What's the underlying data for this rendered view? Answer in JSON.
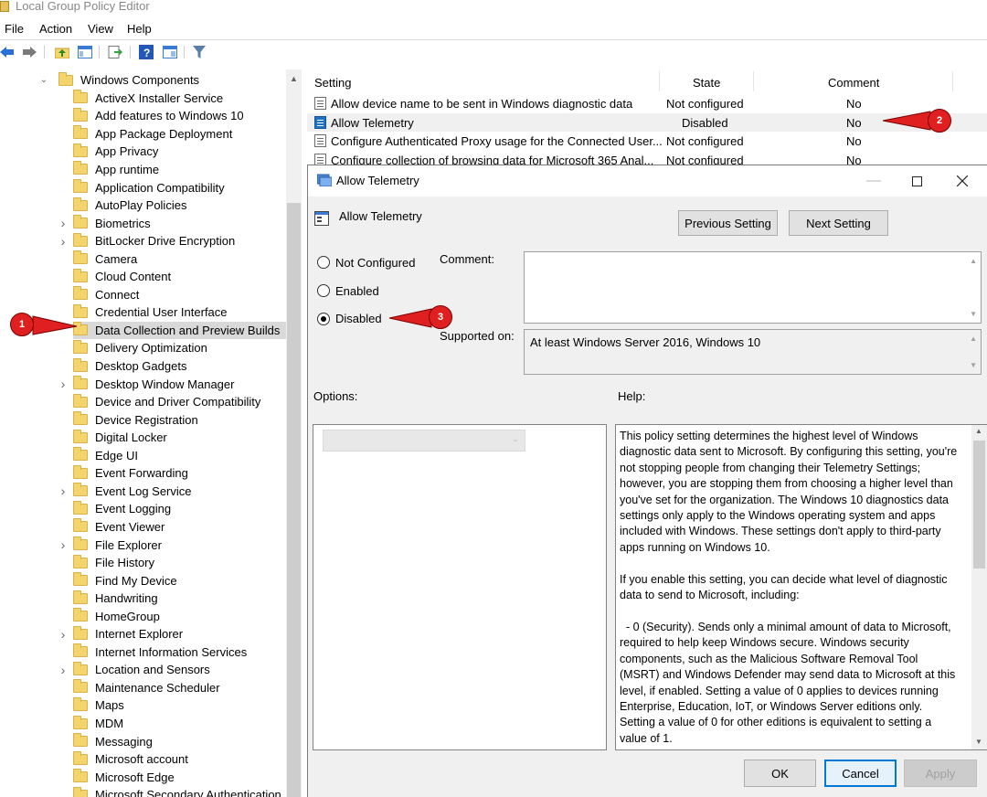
{
  "window": {
    "title": "Local Group Policy Editor"
  },
  "menu": [
    "File",
    "Action",
    "View",
    "Help"
  ],
  "toolbar_icons": [
    "back-icon",
    "forward-icon",
    "up-folder-icon",
    "show-hide-tree-icon",
    "export-list-icon",
    "help-icon",
    "properties-icon",
    "filter-icon"
  ],
  "tree": {
    "root": "Windows Components",
    "items": [
      {
        "label": "ActiveX Installer Service",
        "expandable": false
      },
      {
        "label": "Add features to Windows 10",
        "expandable": false
      },
      {
        "label": "App Package Deployment",
        "expandable": false
      },
      {
        "label": "App Privacy",
        "expandable": false
      },
      {
        "label": "App runtime",
        "expandable": false
      },
      {
        "label": "Application Compatibility",
        "expandable": false
      },
      {
        "label": "AutoPlay Policies",
        "expandable": false
      },
      {
        "label": "Biometrics",
        "expandable": true
      },
      {
        "label": "BitLocker Drive Encryption",
        "expandable": true
      },
      {
        "label": "Camera",
        "expandable": false
      },
      {
        "label": "Cloud Content",
        "expandable": false
      },
      {
        "label": "Connect",
        "expandable": false
      },
      {
        "label": "Credential User Interface",
        "expandable": false
      },
      {
        "label": "Data Collection and Preview Builds",
        "expandable": false,
        "selected": true
      },
      {
        "label": "Delivery Optimization",
        "expandable": false
      },
      {
        "label": "Desktop Gadgets",
        "expandable": false
      },
      {
        "label": "Desktop Window Manager",
        "expandable": true
      },
      {
        "label": "Device and Driver Compatibility",
        "expandable": false
      },
      {
        "label": "Device Registration",
        "expandable": false
      },
      {
        "label": "Digital Locker",
        "expandable": false
      },
      {
        "label": "Edge UI",
        "expandable": false
      },
      {
        "label": "Event Forwarding",
        "expandable": false
      },
      {
        "label": "Event Log Service",
        "expandable": true
      },
      {
        "label": "Event Logging",
        "expandable": false
      },
      {
        "label": "Event Viewer",
        "expandable": false
      },
      {
        "label": "File Explorer",
        "expandable": true
      },
      {
        "label": "File History",
        "expandable": false
      },
      {
        "label": "Find My Device",
        "expandable": false
      },
      {
        "label": "Handwriting",
        "expandable": false
      },
      {
        "label": "HomeGroup",
        "expandable": false
      },
      {
        "label": "Internet Explorer",
        "expandable": true
      },
      {
        "label": "Internet Information Services",
        "expandable": false
      },
      {
        "label": "Location and Sensors",
        "expandable": true
      },
      {
        "label": "Maintenance Scheduler",
        "expandable": false
      },
      {
        "label": "Maps",
        "expandable": false
      },
      {
        "label": "MDM",
        "expandable": false
      },
      {
        "label": "Messaging",
        "expandable": false
      },
      {
        "label": "Microsoft account",
        "expandable": false
      },
      {
        "label": "Microsoft Edge",
        "expandable": false
      },
      {
        "label": "Microsoft Secondary Authentication",
        "expandable": false
      }
    ]
  },
  "list": {
    "columns": {
      "setting": "Setting",
      "state": "State",
      "comment": "Comment"
    },
    "rows": [
      {
        "setting": "Allow device name to be sent in Windows diagnostic data",
        "state": "Not configured",
        "comment": "No"
      },
      {
        "setting": "Allow Telemetry",
        "state": "Disabled",
        "comment": "No",
        "selected": true
      },
      {
        "setting": "Configure Authenticated Proxy usage for the Connected User...",
        "state": "Not configured",
        "comment": "No"
      },
      {
        "setting": "Configure collection of browsing data for Microsoft 365 Anal...",
        "state": "Not configured",
        "comment": "No"
      }
    ]
  },
  "dialog": {
    "title": "Allow Telemetry",
    "setting_name": "Allow Telemetry",
    "prev_button": "Previous Setting",
    "next_button": "Next Setting",
    "radio_not_configured": "Not Configured",
    "radio_enabled": "Enabled",
    "radio_disabled": "Disabled",
    "selected_option": "Disabled",
    "comment_label": "Comment:",
    "comment_value": "",
    "supported_label": "Supported on:",
    "supported_value": "At least Windows Server 2016, Windows 10",
    "options_label": "Options:",
    "help_label": "Help:",
    "help_text": "This policy setting determines the highest level of Windows diagnostic data sent to Microsoft. By configuring this setting, you're not stopping people from changing their Telemetry Settings; however, you are stopping them from choosing a higher level than you've set for the organization. The Windows 10 diagnostics data settings only apply to the Windows operating system and apps included with Windows. These settings don't apply to third-party apps running on Windows 10.\n\nIf you enable this setting, you can decide what level of diagnostic data to send to Microsoft, including:\n\n  - 0 (Security). Sends only a minimal amount of data to Microsoft, required to help keep Windows secure. Windows security components, such as the Malicious Software Removal Tool (MSRT) and Windows Defender may send data to Microsoft at this level, if enabled. Setting a value of 0 applies to devices running Enterprise, Education, IoT, or Windows Server editions only. Setting a value of 0 for other editions is equivalent to setting a value of 1.",
    "ok_button": "OK",
    "cancel_button": "Cancel",
    "apply_button": "Apply"
  },
  "callouts": {
    "one": "1",
    "two": "2",
    "three": "3"
  },
  "colors": {
    "callout": "#e02020",
    "selection": "#d9d9d9",
    "primary_border": "#0078d7"
  }
}
